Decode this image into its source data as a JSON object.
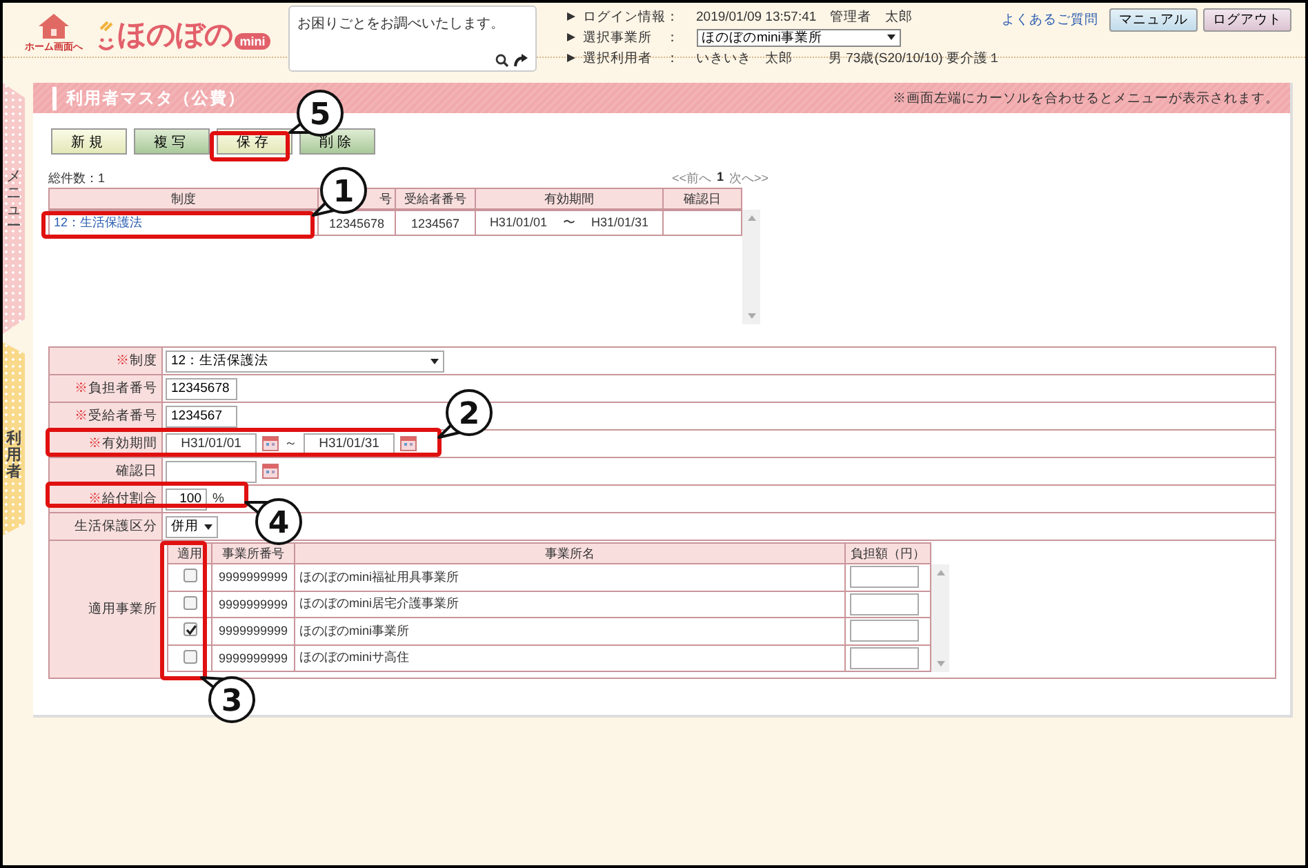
{
  "header": {
    "home_label": "ホーム画面へ",
    "logo": "ほのぼの",
    "logo_badge": "mini",
    "search": {
      "placeholder": "お困りごとをお調べいたします。"
    },
    "info": [
      {
        "kind": "text",
        "label": "ログイン情報",
        "sep": "：",
        "value": "2019/01/09 13:57:41　管理者　太郎"
      },
      {
        "kind": "select",
        "label": "選択事業所",
        "sep": "：",
        "value": "ほのぼのmini事業所"
      },
      {
        "kind": "text",
        "label": "選択利用者",
        "sep": "：",
        "value": "いきいき　太郎",
        "extra": "男 73歳(S20/10/10) 要介護１"
      }
    ],
    "faq_link": "よくあるご質問",
    "buttons": [
      {
        "label": "マニュアル",
        "kind": "blue"
      },
      {
        "label": "ログアウト",
        "kind": "purple"
      }
    ]
  },
  "side_tabs": [
    {
      "label": "メニュー",
      "kind": "menu"
    },
    {
      "label": "利用者",
      "kind": "user"
    }
  ],
  "page": {
    "title": "利用者マスタ（公費）",
    "hint": "※画面左端にカーソルを合わせるとメニューが表示されます。"
  },
  "toolbar": [
    {
      "label": "新規",
      "kind": "light"
    },
    {
      "label": "複写",
      "kind": "green"
    },
    {
      "label": "保存",
      "kind": "light"
    },
    {
      "label": "削除",
      "kind": "green"
    }
  ],
  "list": {
    "total": "総件数：1",
    "pager": {
      "prev": "<<前へ",
      "page": "1",
      "next": "次へ>>"
    },
    "columns": [
      "制度",
      "号",
      "受給者番号",
      "有効期間",
      "確認日"
    ],
    "rows": [
      {
        "system": "12：生活保護法",
        "payer": "12345678",
        "recipient": "1234567",
        "from": "H31/01/01",
        "sep": "〜",
        "to": "H31/01/31"
      }
    ]
  },
  "form": {
    "required_mark": "※",
    "rows": [
      {
        "kind": "select",
        "label": "制度",
        "required": true,
        "value": "12：生活保護法"
      },
      {
        "kind": "text",
        "label": "負担者番号",
        "required": true,
        "value": "12345678"
      },
      {
        "kind": "text",
        "label": "受給者番号",
        "required": true,
        "value": "1234567"
      },
      {
        "kind": "period",
        "label": "有効期間",
        "required": true,
        "from": "H31/01/01",
        "sep": "～",
        "to": "H31/01/31"
      },
      {
        "kind": "date",
        "label": "確認日",
        "required": false
      },
      {
        "kind": "ratio",
        "label": "給付割合",
        "required": true,
        "value": "100",
        "unit": "%"
      },
      {
        "kind": "small_select",
        "label": "生活保護区分",
        "required": false,
        "value": "併用"
      },
      {
        "kind": "offices",
        "label": "適用事業所",
        "required": false,
        "columns": [
          "適用",
          "事業所番号",
          "事業所名",
          "負担額（円）"
        ],
        "offices": [
          {
            "checked": false,
            "number": "9999999999",
            "name": "ほのぼのmini福祉用具事業所"
          },
          {
            "checked": false,
            "number": "9999999999",
            "name": "ほのぼのmini居宅介護事業所"
          },
          {
            "checked": true,
            "number": "9999999999",
            "name": "ほのぼのmini事業所"
          },
          {
            "checked": false,
            "number": "9999999999",
            "name": "ほのぼのminiサ高住"
          }
        ]
      }
    ]
  },
  "callouts": [
    {
      "number": "5"
    },
    {
      "number": "1"
    },
    {
      "number": "2"
    },
    {
      "number": "4"
    },
    {
      "number": "3"
    }
  ]
}
